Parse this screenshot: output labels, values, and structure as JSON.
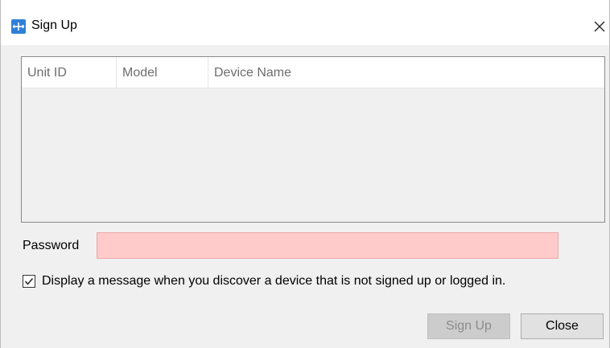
{
  "window": {
    "title": "Sign Up",
    "close_glyph": "✕"
  },
  "table": {
    "columns": [
      "Unit ID",
      "Model",
      "Device Name"
    ],
    "rows": []
  },
  "password": {
    "label": "Password",
    "value": "",
    "field_color": "#ffcaca"
  },
  "option": {
    "checked": true,
    "label": "Display a message when you discover a device that is not signed up or logged in."
  },
  "buttons": {
    "sign_up": "Sign Up",
    "sign_up_enabled": false,
    "close": "Close"
  },
  "colors": {
    "app_icon": "#2f7fd8"
  }
}
